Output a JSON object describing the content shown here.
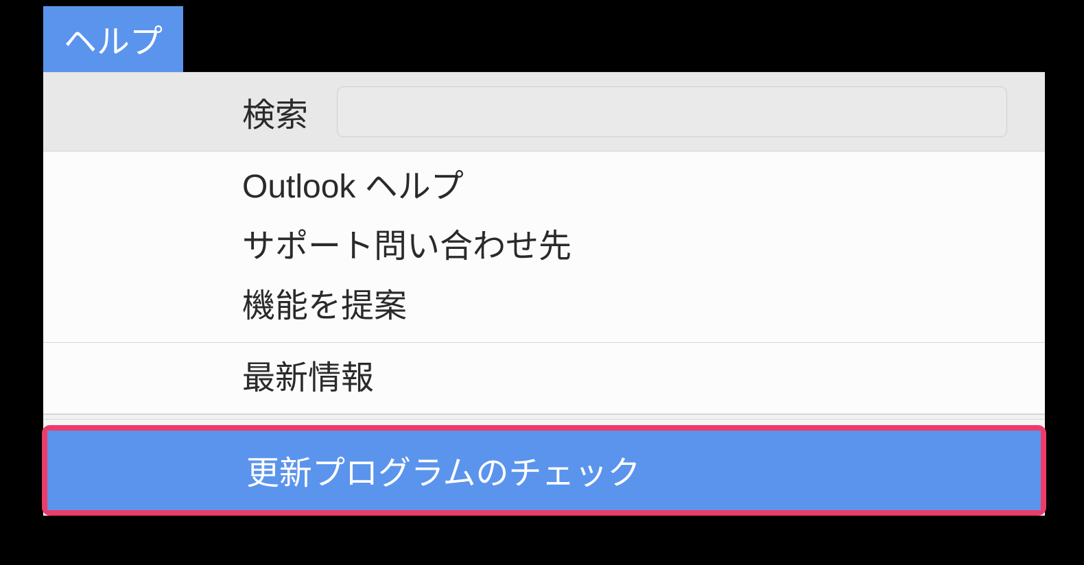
{
  "menu": {
    "title": "ヘルプ",
    "search": {
      "label": "検索",
      "value": ""
    },
    "groups": [
      {
        "items": [
          {
            "label": "Outlook ヘルプ"
          },
          {
            "label": "サポート問い合わせ先"
          },
          {
            "label": "機能を提案"
          }
        ]
      },
      {
        "items": [
          {
            "label": "最新情報"
          }
        ]
      }
    ],
    "highlighted": {
      "label": "更新プログラムのチェック"
    }
  },
  "colors": {
    "menu_blue": "#5b94ec",
    "highlight_border": "#ed3b6a"
  }
}
